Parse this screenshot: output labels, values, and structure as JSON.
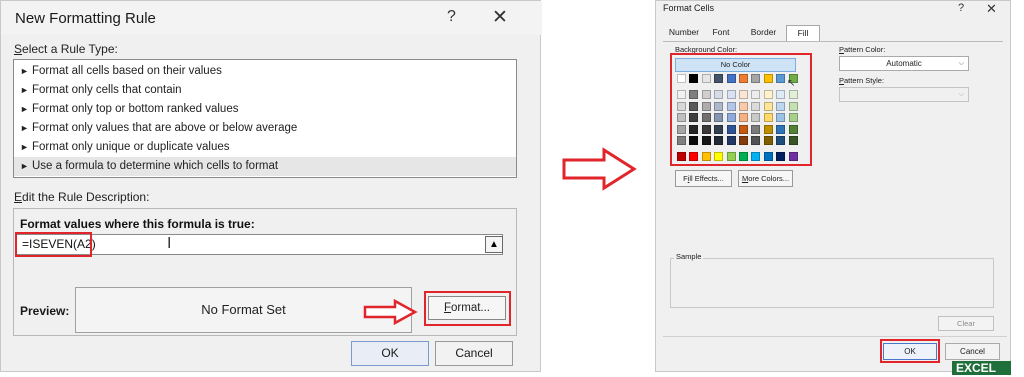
{
  "left_dialog": {
    "title": "New Formatting Rule",
    "help_glyph": "?",
    "close_glyph": "✕",
    "select_rule_type_label": "Select a Rule Type:",
    "rule_types": [
      "Format all cells based on their values",
      "Format only cells that contain",
      "Format only top or bottom ranked values",
      "Format only values that are above or below average",
      "Format only unique or duplicate values",
      "Use a formula to determine which cells to format"
    ],
    "selected_rule_index": 5,
    "edit_description_label": "Edit the Rule Description:",
    "formula_prompt": "Format values where this formula is true:",
    "formula_value": "=ISEVEN(A2)",
    "preview_label": "Preview:",
    "preview_text": "No Format Set",
    "format_button": "Format...",
    "ok_button": "OK",
    "cancel_button": "Cancel"
  },
  "right_dialog": {
    "title": "Format Cells",
    "help_glyph": "?",
    "close_glyph": "✕",
    "tabs": [
      "Number",
      "Font",
      "Border",
      "Fill"
    ],
    "active_tab": "Fill",
    "background_color_label": "Background Color:",
    "no_color_button": "No Color",
    "fill_effects_button": "Fill Effects...",
    "more_colors_button": "More Colors...",
    "pattern_color_label": "Pattern Color:",
    "pattern_color_value": "Automatic",
    "pattern_style_label": "Pattern Style:",
    "pattern_style_value": "",
    "sample_label": "Sample",
    "clear_button": "Clear",
    "ok_button": "OK",
    "cancel_button": "Cancel",
    "palette": {
      "theme_top": [
        "#ffffff",
        "#000000",
        "#e7e6e6",
        "#44546a",
        "#4472c4",
        "#ed7d31",
        "#a5a5a5",
        "#ffc000",
        "#5b9bd5",
        "#70ad47"
      ],
      "theme_shades": [
        [
          "#f2f2f2",
          "#7f7f7f",
          "#d0cece",
          "#d6dce4",
          "#d9e2f3",
          "#fbe5d5",
          "#ededed",
          "#fff2cc",
          "#deebf6",
          "#e2efd9"
        ],
        [
          "#d8d8d8",
          "#595959",
          "#aeabab",
          "#adb9ca",
          "#b4c6e7",
          "#f7cbac",
          "#dbdbdb",
          "#fee599",
          "#bdd7ee",
          "#c5e0b3"
        ],
        [
          "#bfbfbf",
          "#3f3f3f",
          "#757070",
          "#8496b0",
          "#8eaadb",
          "#f4b183",
          "#c9c9c9",
          "#ffd965",
          "#9cc3e5",
          "#a8d08d"
        ],
        [
          "#a5a5a5",
          "#262626",
          "#3a3838",
          "#323f4f",
          "#2f5496",
          "#c55a11",
          "#7b7b7b",
          "#bf9000",
          "#2e75b5",
          "#538135"
        ],
        [
          "#7f7f7f",
          "#0c0c0c",
          "#171616",
          "#222a35",
          "#1f3864",
          "#833c0b",
          "#525252",
          "#7f6000",
          "#1e4e79",
          "#375623"
        ]
      ],
      "standard": [
        "#c00000",
        "#ff0000",
        "#ffc000",
        "#ffff00",
        "#92d050",
        "#00b050",
        "#00b0f0",
        "#0070c0",
        "#002060",
        "#7030a0"
      ]
    }
  },
  "arrows": {
    "middle_arrow": "right-arrow-icon",
    "format_pointer_arrow": "right-arrow-icon",
    "accent_color": "#e0262b"
  },
  "badge": {
    "text": "EXCEL"
  }
}
